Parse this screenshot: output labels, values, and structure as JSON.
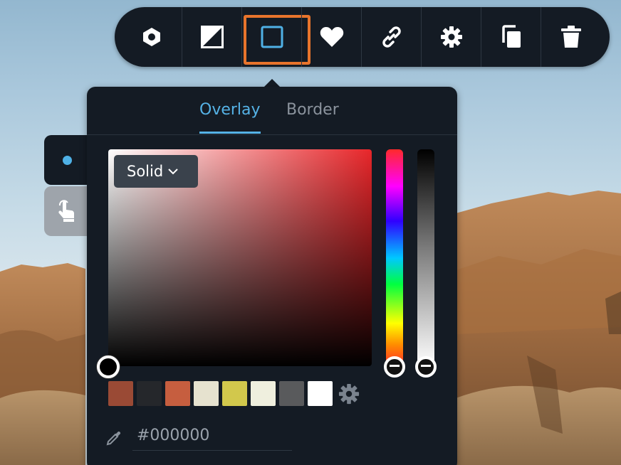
{
  "colors": {
    "accent": "#55b2e6",
    "toolbar_bg": "#141b24",
    "selection_outline": "#e8742c"
  },
  "toolbar": {
    "items": [
      {
        "icon": "hexagon-nut-icon"
      },
      {
        "icon": "diagonal-square-icon"
      },
      {
        "icon": "square-outline-icon",
        "selected": true
      },
      {
        "icon": "heart-icon"
      },
      {
        "icon": "link-icon"
      },
      {
        "icon": "gear-icon"
      },
      {
        "icon": "copy-icon"
      },
      {
        "icon": "trash-icon"
      }
    ]
  },
  "side_tabs": [
    {
      "icon": "dot-icon",
      "active": true
    },
    {
      "icon": "hand-pointer-icon",
      "active": false
    }
  ],
  "panel": {
    "tabs": {
      "overlay": "Overlay",
      "border": "Border"
    },
    "active_tab": "Overlay",
    "mode_select": {
      "label": "Solid"
    },
    "swatches": [
      "#9a4a35",
      "#25272b",
      "#c65e3f",
      "#e6e2cf",
      "#d2c84c",
      "#efefde",
      "#595a5c",
      "#ffffff"
    ],
    "hex_value": "#000000"
  }
}
